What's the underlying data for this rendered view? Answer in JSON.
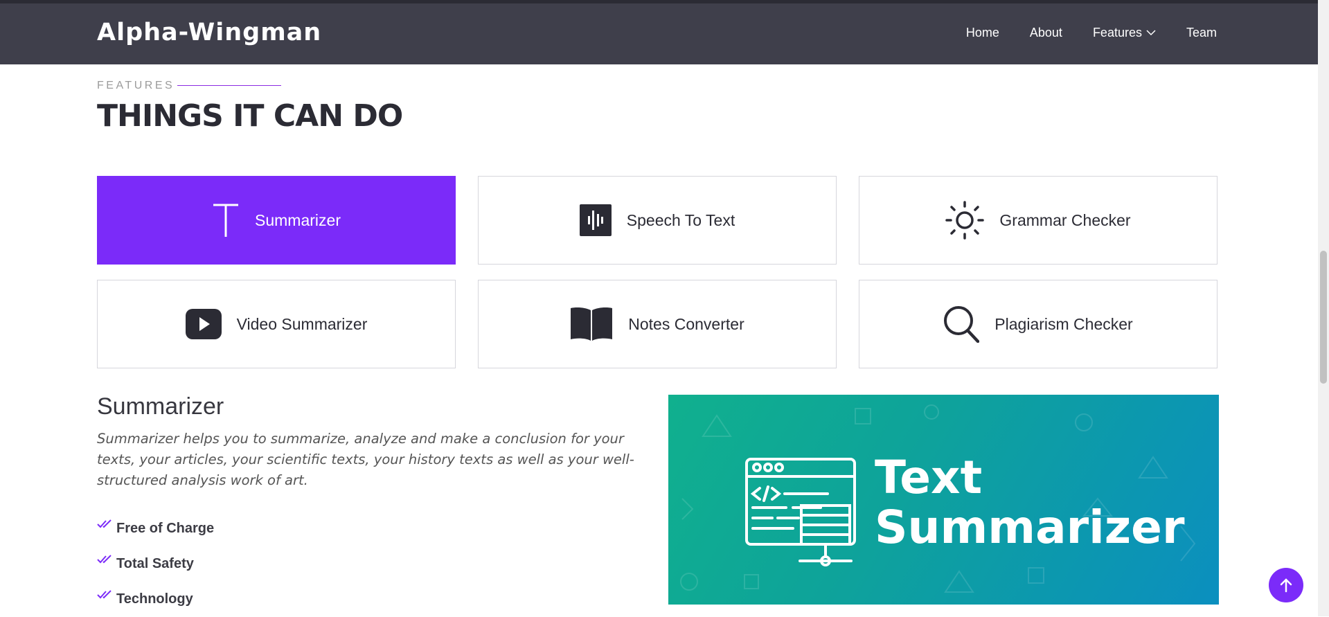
{
  "header": {
    "logo": "Alpha-Wingman",
    "nav": [
      {
        "label": "Home"
      },
      {
        "label": "About"
      },
      {
        "label": "Features"
      },
      {
        "label": "Team"
      }
    ]
  },
  "section": {
    "label": "FEATURES",
    "title": "THINGS IT CAN DO"
  },
  "tabs": [
    {
      "label": "Summarizer",
      "icon": "text-icon",
      "active": true
    },
    {
      "label": "Speech To Text",
      "icon": "audio-wave-icon",
      "active": false
    },
    {
      "label": "Grammar Checker",
      "icon": "sun-icon",
      "active": false
    },
    {
      "label": "Video Summarizer",
      "icon": "youtube-play-icon",
      "active": false
    },
    {
      "label": "Notes Converter",
      "icon": "book-icon",
      "active": false
    },
    {
      "label": "Plagiarism Checker",
      "icon": "search-icon",
      "active": false
    }
  ],
  "content": {
    "title": "Summarizer",
    "description": "Summarizer helps you to summarize, analyze and make a conclusion for your texts, your articles, your scientific texts, your history texts as well as your well-structured analysis work of art.",
    "features": [
      "Free of Charge",
      "Total Safety",
      "Technology"
    ]
  },
  "banner": {
    "line1": "Text",
    "line2": "Summarizer"
  },
  "colors": {
    "accent": "#7b2bf9",
    "header": "#3f3f4b",
    "banner_start": "#10b08e",
    "banner_end": "#0b8fbf"
  }
}
